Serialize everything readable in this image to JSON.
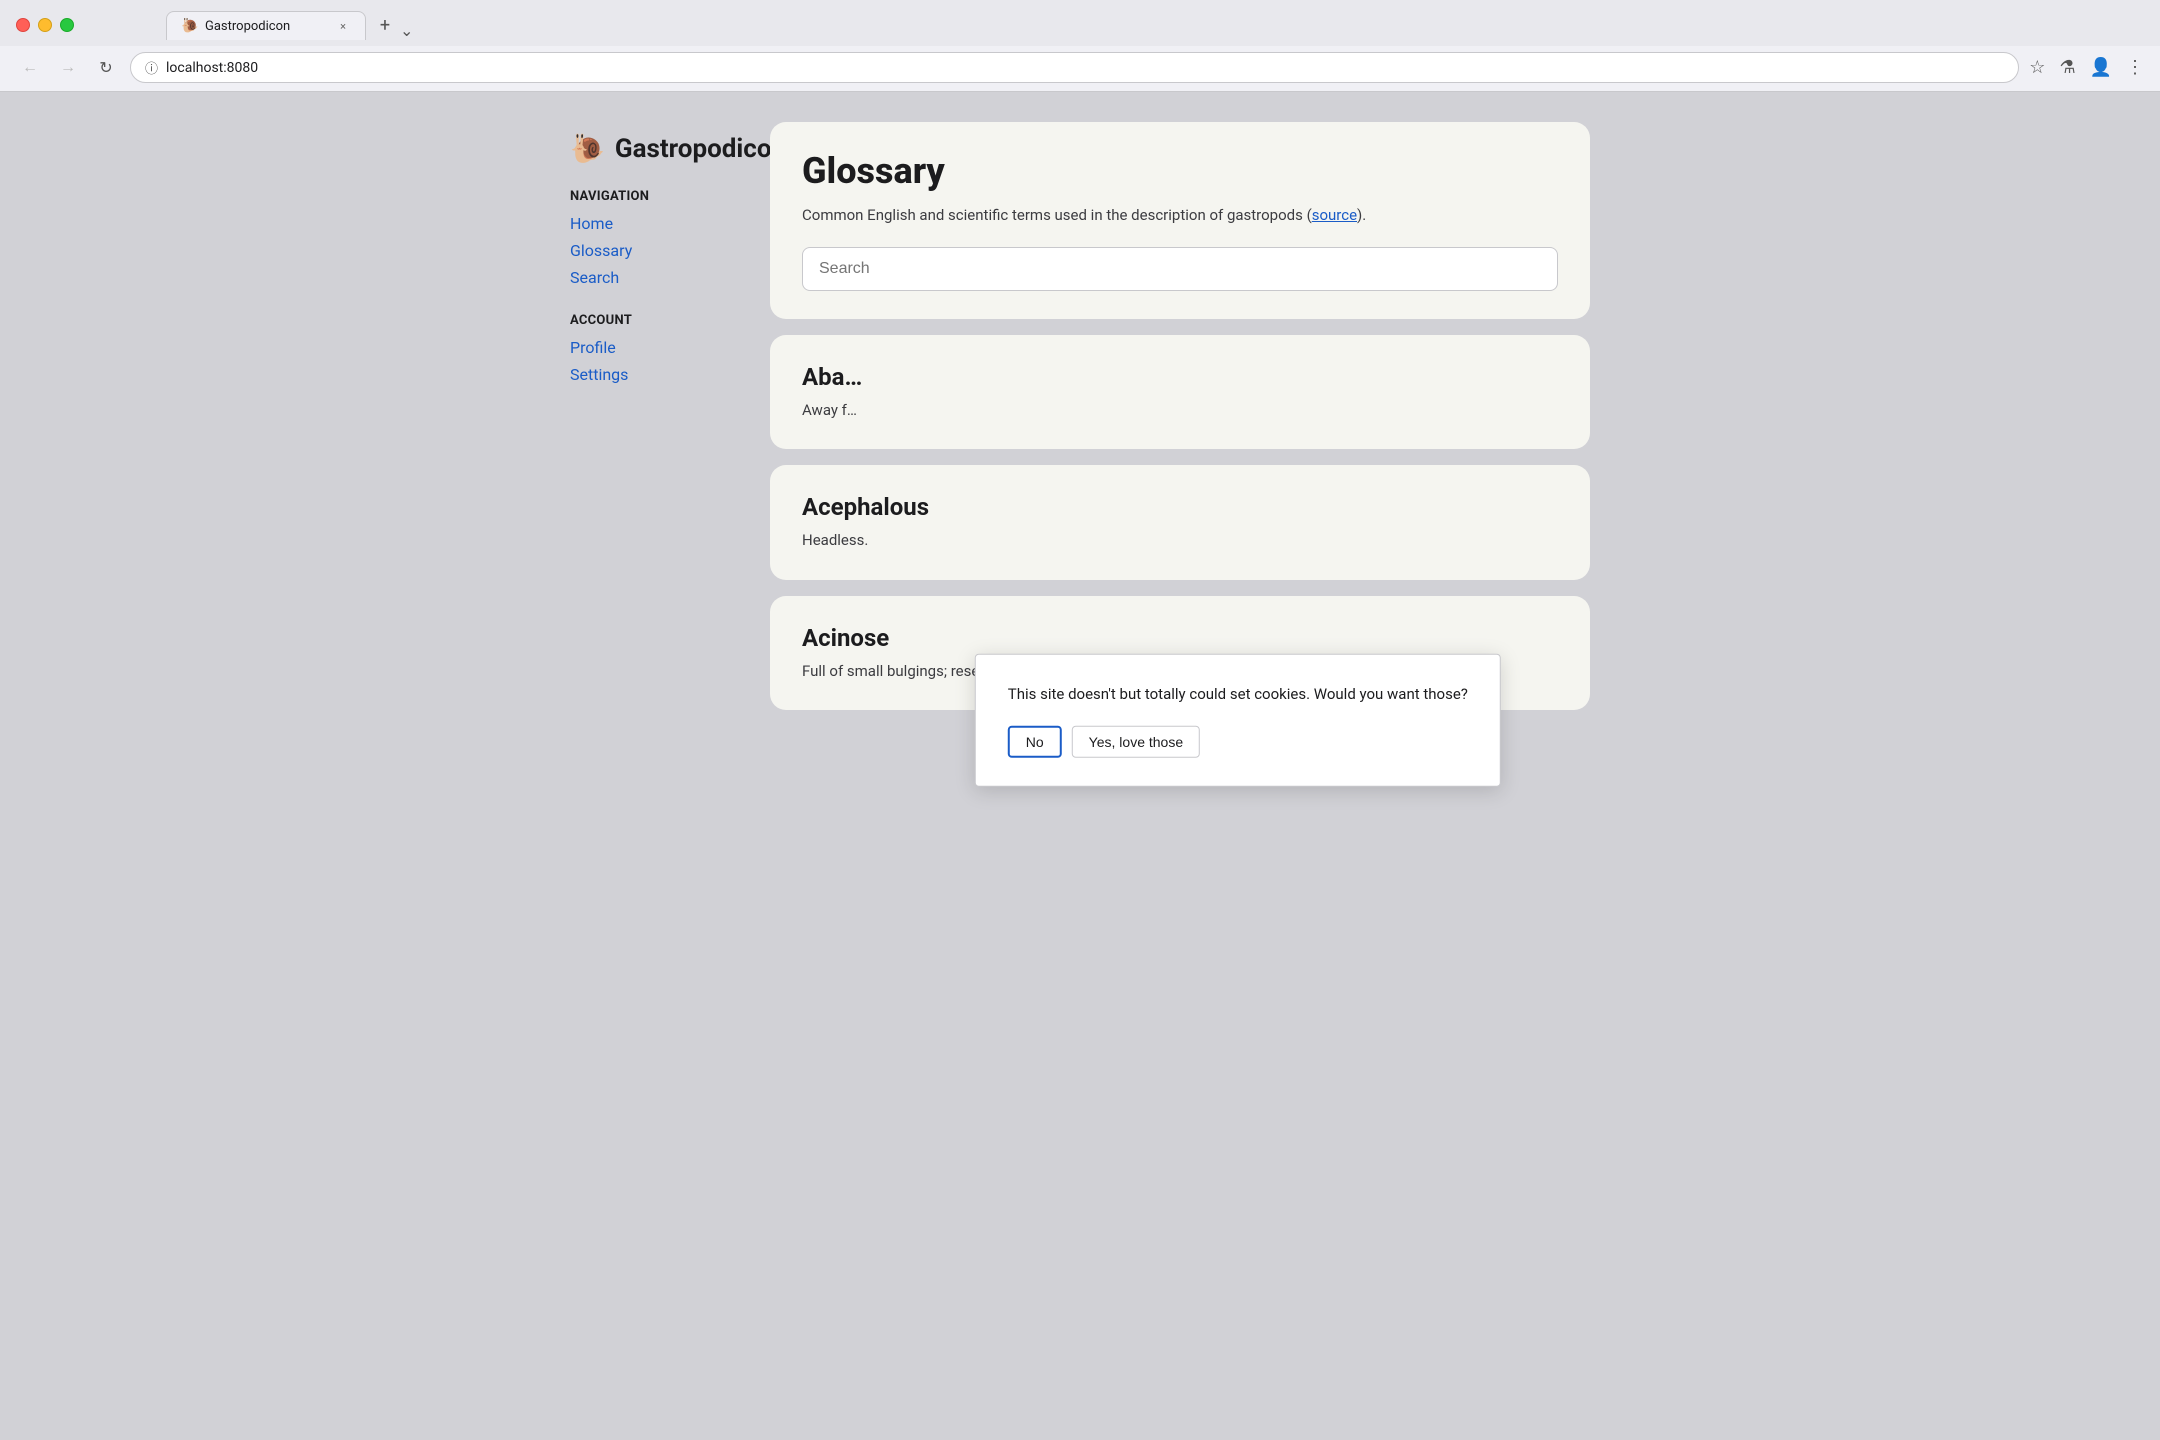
{
  "browser": {
    "tab_title": "Gastropodicon",
    "tab_favicon": "🐌",
    "tab_close_label": "×",
    "new_tab_label": "+",
    "tab_dropdown_label": "⌄",
    "back_button": "←",
    "forward_button": "→",
    "refresh_button": "↻",
    "address": "localhost:8080",
    "address_icon": "ⓘ",
    "bookmark_icon": "☆",
    "experiment_icon": "⚗",
    "profile_icon": "👤",
    "menu_icon": "⋮"
  },
  "site": {
    "logo_emoji": "🐌",
    "logo_text": "Gastropodicon"
  },
  "sidebar": {
    "nav_section_title": "NAVIGATION",
    "nav_items": [
      {
        "label": "Home",
        "href": "#"
      },
      {
        "label": "Glossary",
        "href": "#"
      },
      {
        "label": "Search",
        "href": "#"
      }
    ],
    "account_section_title": "ACCOUNT",
    "account_items": [
      {
        "label": "Profile",
        "href": "#"
      },
      {
        "label": "Settings",
        "href": "#"
      }
    ]
  },
  "main": {
    "glossary_title": "Glossary",
    "glossary_description": "Common English and scientific terms used in the description of gastropods (",
    "glossary_source_link": "source",
    "glossary_description_end": ").",
    "search_placeholder": "Search",
    "terms": [
      {
        "name": "Aba…",
        "definition": "Away f…"
      },
      {
        "name": "Acephalous",
        "definition": "Headless."
      },
      {
        "name": "Acinose",
        "definition": "Full of small bulgings; resembling the kernel in a nut."
      }
    ]
  },
  "cookie_dialog": {
    "message": "This site doesn't but totally could set cookies. Would you want those?",
    "btn_no_label": "No",
    "btn_yes_label": "Yes, love those"
  }
}
